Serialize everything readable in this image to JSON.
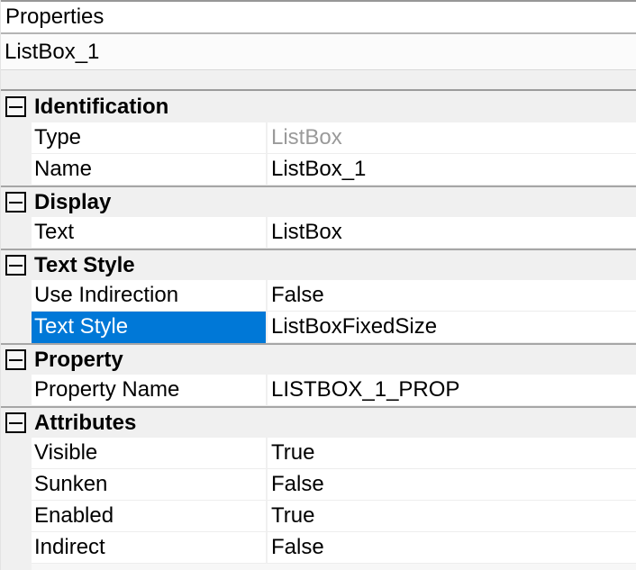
{
  "panel": {
    "title": "Properties"
  },
  "name_field": {
    "value": "ListBox_1"
  },
  "colors": {
    "accent": "#0078d7",
    "disabled_text": "#9a9a9a",
    "gutter_bg": "#f0f0f0",
    "section_border": "#a6a6a6"
  },
  "icons": {
    "collapse": "minus-box"
  },
  "sections": [
    {
      "label": "Identification",
      "rows": [
        {
          "label": "Type",
          "value": "ListBox",
          "disabled": true
        },
        {
          "label": "Name",
          "value": "ListBox_1"
        }
      ]
    },
    {
      "label": "Display",
      "rows": [
        {
          "label": "Text",
          "value": "ListBox"
        }
      ]
    },
    {
      "label": "Text Style",
      "rows": [
        {
          "label": "Use Indirection",
          "value": "False"
        },
        {
          "label": "Text Style",
          "value": "ListBoxFixedSize",
          "selected": true
        }
      ]
    },
    {
      "label": "Property",
      "rows": [
        {
          "label": "Property Name",
          "value": "LISTBOX_1_PROP"
        }
      ]
    },
    {
      "label": "Attributes",
      "rows": [
        {
          "label": "Visible",
          "value": "True"
        },
        {
          "label": "Sunken",
          "value": "False"
        },
        {
          "label": "Enabled",
          "value": "True"
        },
        {
          "label": "Indirect",
          "value": "False"
        }
      ]
    }
  ]
}
